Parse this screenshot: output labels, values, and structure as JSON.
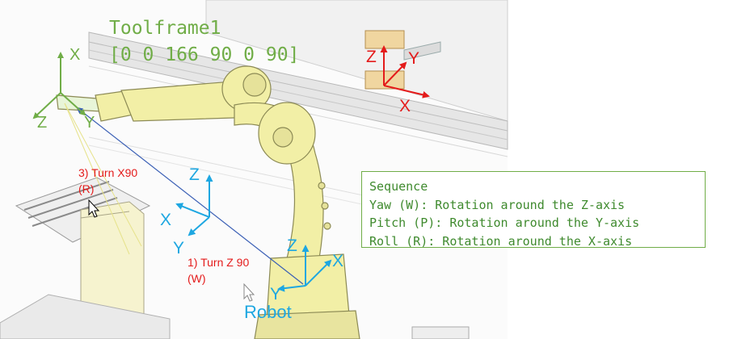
{
  "toolframe": {
    "title": "Toolframe1",
    "values": "[0 0 166 90 0 90]"
  },
  "frames": {
    "toolframe": {
      "x": "X",
      "y": "Y",
      "z": "Z"
    },
    "user": {
      "x": "X",
      "y": "Y",
      "z": "Z"
    },
    "mid": {
      "x": "X",
      "y": "Y",
      "z": "Z"
    },
    "robot": {
      "x": "X",
      "y": "Y",
      "z": "Z",
      "label": "Robot"
    }
  },
  "steps": {
    "step1_line1": "1) Turn Z 90",
    "step1_line2": "(W)",
    "step3_line1": "3) Turn X90",
    "step3_line2": "(R)"
  },
  "sequence": {
    "title": "Sequence",
    "lines": [
      "Yaw (W): Rotation around the Z-axis",
      "Pitch (P): Rotation around the Y-axis",
      "Roll (R): Rotation around the X-axis"
    ]
  },
  "colors": {
    "green": "#70ad47",
    "red": "#e41b1b",
    "blue": "#1ea7e1",
    "robot_body": "#f2efa6"
  }
}
